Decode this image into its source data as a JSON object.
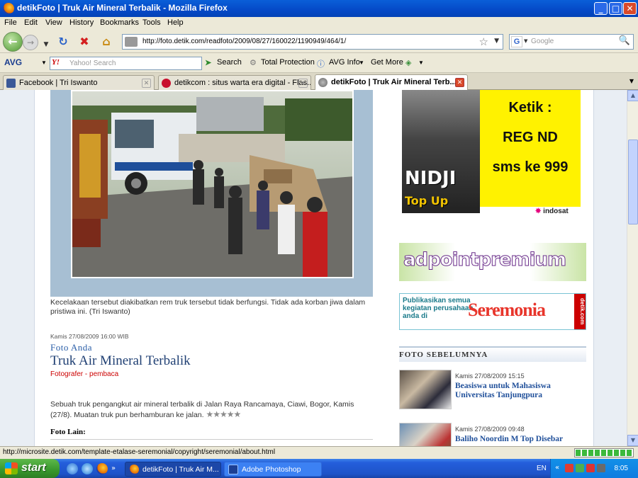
{
  "window": {
    "title": "detikFoto | Truk Air Mineral Terbalik - Mozilla Firefox",
    "controls": {
      "minimize": "_",
      "maximize": "□",
      "close": "✕"
    }
  },
  "menu": [
    "File",
    "Edit",
    "View",
    "History",
    "Bookmarks",
    "Tools",
    "Help"
  ],
  "nav": {
    "url": "http://foto.detik.com/readfoto/2009/08/27/160022/1190949/464/1/",
    "search_engine": "G",
    "search_placeholder": "Google"
  },
  "avg_toolbar": {
    "logo": "AVG",
    "yahoo_logo": "Y!",
    "yahoo_placeholder": "Yahoo! Search",
    "search_label": "Search",
    "protection_label": "Total Protection",
    "info_label": "AVG Info",
    "more_label": "Get More"
  },
  "tabs": [
    {
      "label": "Facebook | Tri Iswanto",
      "color": "#3b5998"
    },
    {
      "label": "detikcom : situs warta era digital - Flas...",
      "color": "#c8102e"
    },
    {
      "label": "detikFoto | Truk Air Mineral Terb...",
      "color": "#888888",
      "active": true
    }
  ],
  "article": {
    "caption": "Kecelakaan tersebut diakibatkan rem truk tersebut tidak berfungsi. Tidak ada korban jiwa dalam pristiwa ini. (Tri Iswanto)",
    "date": "Kamis 27/08/2009 16:00 WIB",
    "kicker": "Foto Anda",
    "headline": "Truk Air Mineral Terbalik",
    "photographer_label": "Fotografer",
    "photographer_sep": " - ",
    "photographer_name": "pembaca",
    "body": "Sebuah truk pengangkut air mineral terbalik di Jalan Raya Rancamaya, Ciawi, Bogor, Kamis (27/8). Muatan truk pun berhamburan ke jalan.",
    "rating_stars": "★★★★★",
    "other_photos_label": "Foto Lain:"
  },
  "ads": {
    "nidji": {
      "line1": "Ketik :",
      "line2": "REG ND",
      "line3": "sms ke 999",
      "brand": "NIDJI",
      "topup": "Top Up",
      "operator": "indosat"
    },
    "adpoint": {
      "text": "adpointpremium"
    },
    "seremonia": {
      "left_text": "Publikasikan semua kegiatan perusahaan anda di",
      "brand": "Seremonia",
      "side": "detik.com"
    }
  },
  "sidebar": {
    "section_title": "FOTO SEBELUMNYA",
    "items": [
      {
        "date": "Kamis 27/08/2009 15:15",
        "title": "Beasiswa untuk Mahasiswa Universitas Tanjungpura"
      },
      {
        "date": "Kamis 27/08/2009 09:48",
        "title": "Baliho Noordin M Top Disebar"
      }
    ]
  },
  "status": {
    "text": "http://microsite.detik.com/template-etalase-seremonial/copyright/seremonial/about.html"
  },
  "taskbar": {
    "start_label": "start",
    "tasks": [
      {
        "label": "detikFoto | Truk Air M...",
        "icon_color": "#e66b00"
      },
      {
        "label": "Adobe Photoshop",
        "icon_color": "#1c3f94"
      }
    ],
    "language": "EN",
    "clock": "8:05"
  }
}
